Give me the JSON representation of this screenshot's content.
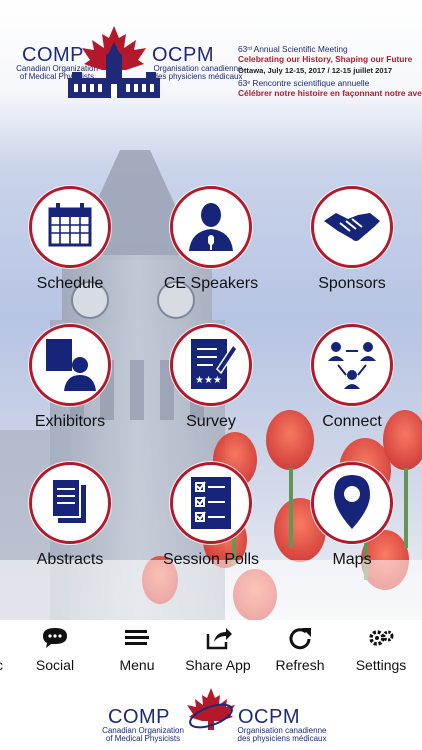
{
  "header": {
    "logo_left_word": "COMP",
    "logo_right_word": "OCPM",
    "logo_left_sub_1": "Canadian Organization",
    "logo_left_sub_2": "of Medical Physicists",
    "logo_right_sub_1": "Organisation canadienne",
    "logo_right_sub_2": "des physiciens médicaux",
    "meeting_en_num": "63",
    "meeting_en_sup": "rd",
    "meeting_en_title": " Annual Scientific Meeting",
    "meeting_en_theme": "Celebrating our History, Shaping our Future",
    "meeting_dates": "Ottawa, July 12-15, 2017 / 12-15 juillet 2017",
    "meeting_fr_num": "63",
    "meeting_fr_sup": "e",
    "meeting_fr_title": " Rencontre scientifique annuelle",
    "meeting_fr_theme": "Célébrer notre histoire en façonnant notre avenir"
  },
  "grid": {
    "schedule": "Schedule",
    "ce_speakers": "CE Speakers",
    "sponsors": "Sponsors",
    "exhibitors": "Exhibitors",
    "survey": "Survey",
    "connect": "Connect",
    "abstracts": "Abstracts",
    "session_polls": "Session Polls",
    "maps": "Maps"
  },
  "bottom_nav": {
    "partial": "c",
    "social": "Social",
    "menu": "Menu",
    "share_app": "Share App",
    "refresh": "Refresh",
    "settings": "Settings"
  },
  "footer": {
    "logo_left_word": "COMP",
    "logo_right_word": "OCPM",
    "logo_left_sub_1": "Canadian Organization",
    "logo_left_sub_2": "of Medical Physicists",
    "logo_right_sub_1": "Organisation canadienne",
    "logo_right_sub_2": "des physiciens médicaux"
  },
  "colors": {
    "brand_navy": "#1e2a78",
    "brand_red": "#b3192b",
    "icon_navy": "#16247a"
  },
  "icons": [
    "calendar-icon",
    "speaker-icon",
    "handshake-icon",
    "exhibitor-icon",
    "survey-icon",
    "connect-icon",
    "abstracts-icon",
    "polls-icon",
    "map-pin-icon",
    "chat-icon",
    "menu-icon",
    "share-icon",
    "refresh-icon",
    "gears-icon",
    "maple-leaf-icon"
  ]
}
